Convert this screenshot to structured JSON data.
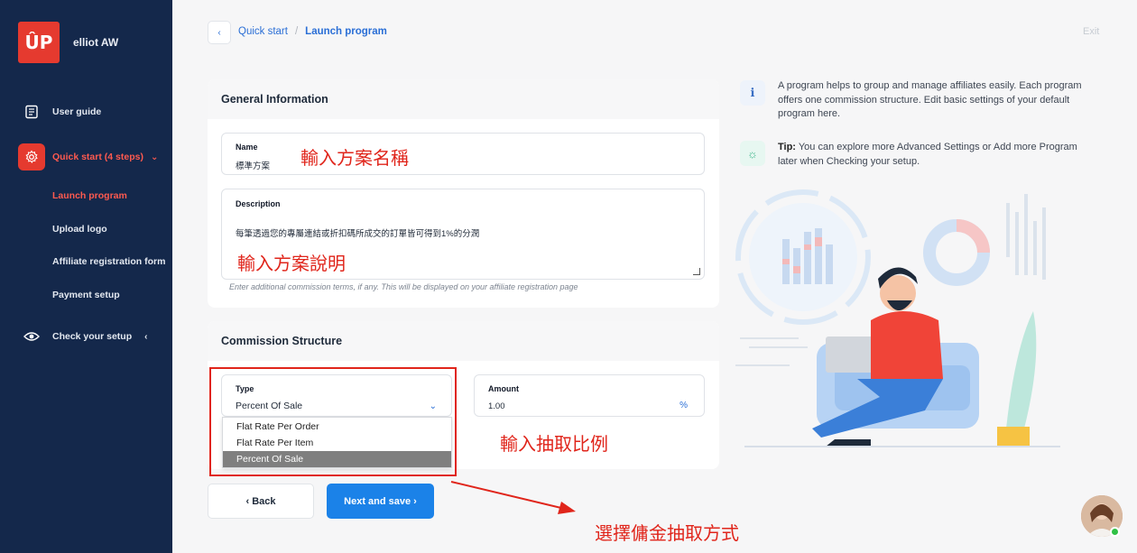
{
  "sidebar": {
    "brand_logo": "ÛP",
    "brand_name": "elliot AW",
    "items": [
      {
        "label": "User guide"
      },
      {
        "label": "Quick start (4 steps)"
      },
      {
        "label": "Check your setup"
      }
    ],
    "sub_items": [
      {
        "label": "Launch program"
      },
      {
        "label": "Upload logo"
      },
      {
        "label": "Affiliate registration form"
      },
      {
        "label": "Payment setup"
      }
    ]
  },
  "header": {
    "crumb_1": "Quick start",
    "separator": "/",
    "crumb_2": "Launch program",
    "exit": "Exit"
  },
  "general": {
    "title": "General Information",
    "name_label": "Name",
    "name_value": "標準方案",
    "desc_label": "Description",
    "desc_value": "每筆透過您的專屬連結或折扣碼所成交的訂單皆可得到1%的分潤",
    "hint": "Enter additional commission terms, if any. This will be displayed on your affiliate registration page"
  },
  "commission": {
    "title": "Commission Structure",
    "type_label": "Type",
    "type_value": "Percent Of Sale",
    "amount_label": "Amount",
    "amount_value": "1.00",
    "amount_unit": "%",
    "options": [
      "Flat Rate Per Order",
      "Flat Rate Per Item",
      "Percent Of Sale"
    ],
    "selected_option": "Percent Of Sale"
  },
  "buttons": {
    "back": "‹ Back",
    "next": "Next and save ›"
  },
  "info": {
    "text_1": "A program helps to group and manage affiliates easily. Each program offers one commission structure. Edit basic settings of your default program here.",
    "tip_label": "Tip:",
    "tip_text": " You can explore more Advanced Settings or Add more Program later when Checking your setup."
  },
  "annotations": {
    "name_note": "輸入方案名稱",
    "desc_note": "輸入方案說明",
    "amount_note": "輸入抽取比例",
    "type_note": "選擇傭金抽取方式"
  },
  "colors": {
    "sidebar_bg": "#14284b",
    "accent_red": "#e53a2f",
    "primary_blue": "#1b82e8",
    "annotation_red": "#e0251b"
  }
}
